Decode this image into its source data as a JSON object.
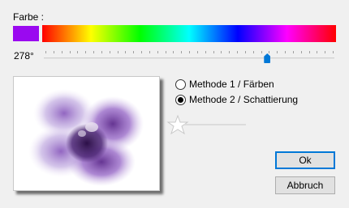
{
  "color": {
    "label": "Farbe :",
    "selected_swatch": "#9a09f0"
  },
  "hue": {
    "value_text": "278°",
    "slider_value_fraction": 0.772
  },
  "options": {
    "method1": "Methode 1 / Färben",
    "method2": "Methode 2 / Schattierung",
    "selected": 2
  },
  "preview": {
    "icon": "purple-flower-image"
  },
  "buttons": {
    "ok": "Ok",
    "cancel": "Abbruch"
  },
  "accent": "#0078d7"
}
